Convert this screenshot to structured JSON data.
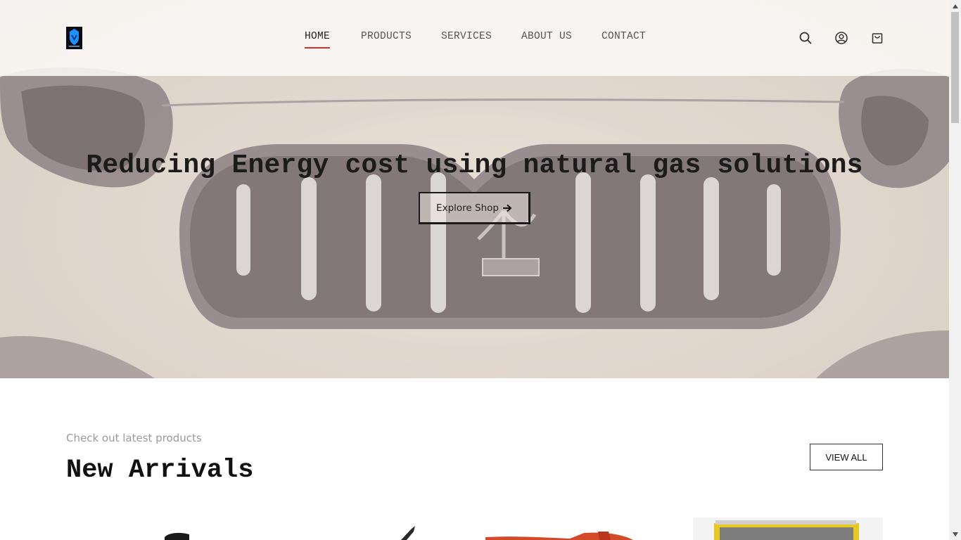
{
  "header": {
    "logo_icon": "shield-logo-icon",
    "nav": [
      {
        "label": "HOME",
        "active": true
      },
      {
        "label": "PRODUCTS",
        "active": false
      },
      {
        "label": "SERVICES",
        "active": false
      },
      {
        "label": "ABOUT US",
        "active": false
      },
      {
        "label": "CONTACT",
        "active": false
      }
    ],
    "icons": [
      "search-icon",
      "user-icon",
      "cart-icon"
    ]
  },
  "hero": {
    "title": "Reducing Energy cost using natural gas solutions",
    "button_label": "Explore Shop",
    "button_icon": "arrow-right-icon"
  },
  "new_arrivals": {
    "subtitle": "Check out latest products",
    "title": "New Arrivals",
    "view_all_label": "VIEW ALL"
  },
  "colors": {
    "active_underline": "#d0302b",
    "logo_accent": "#1e90ff"
  }
}
